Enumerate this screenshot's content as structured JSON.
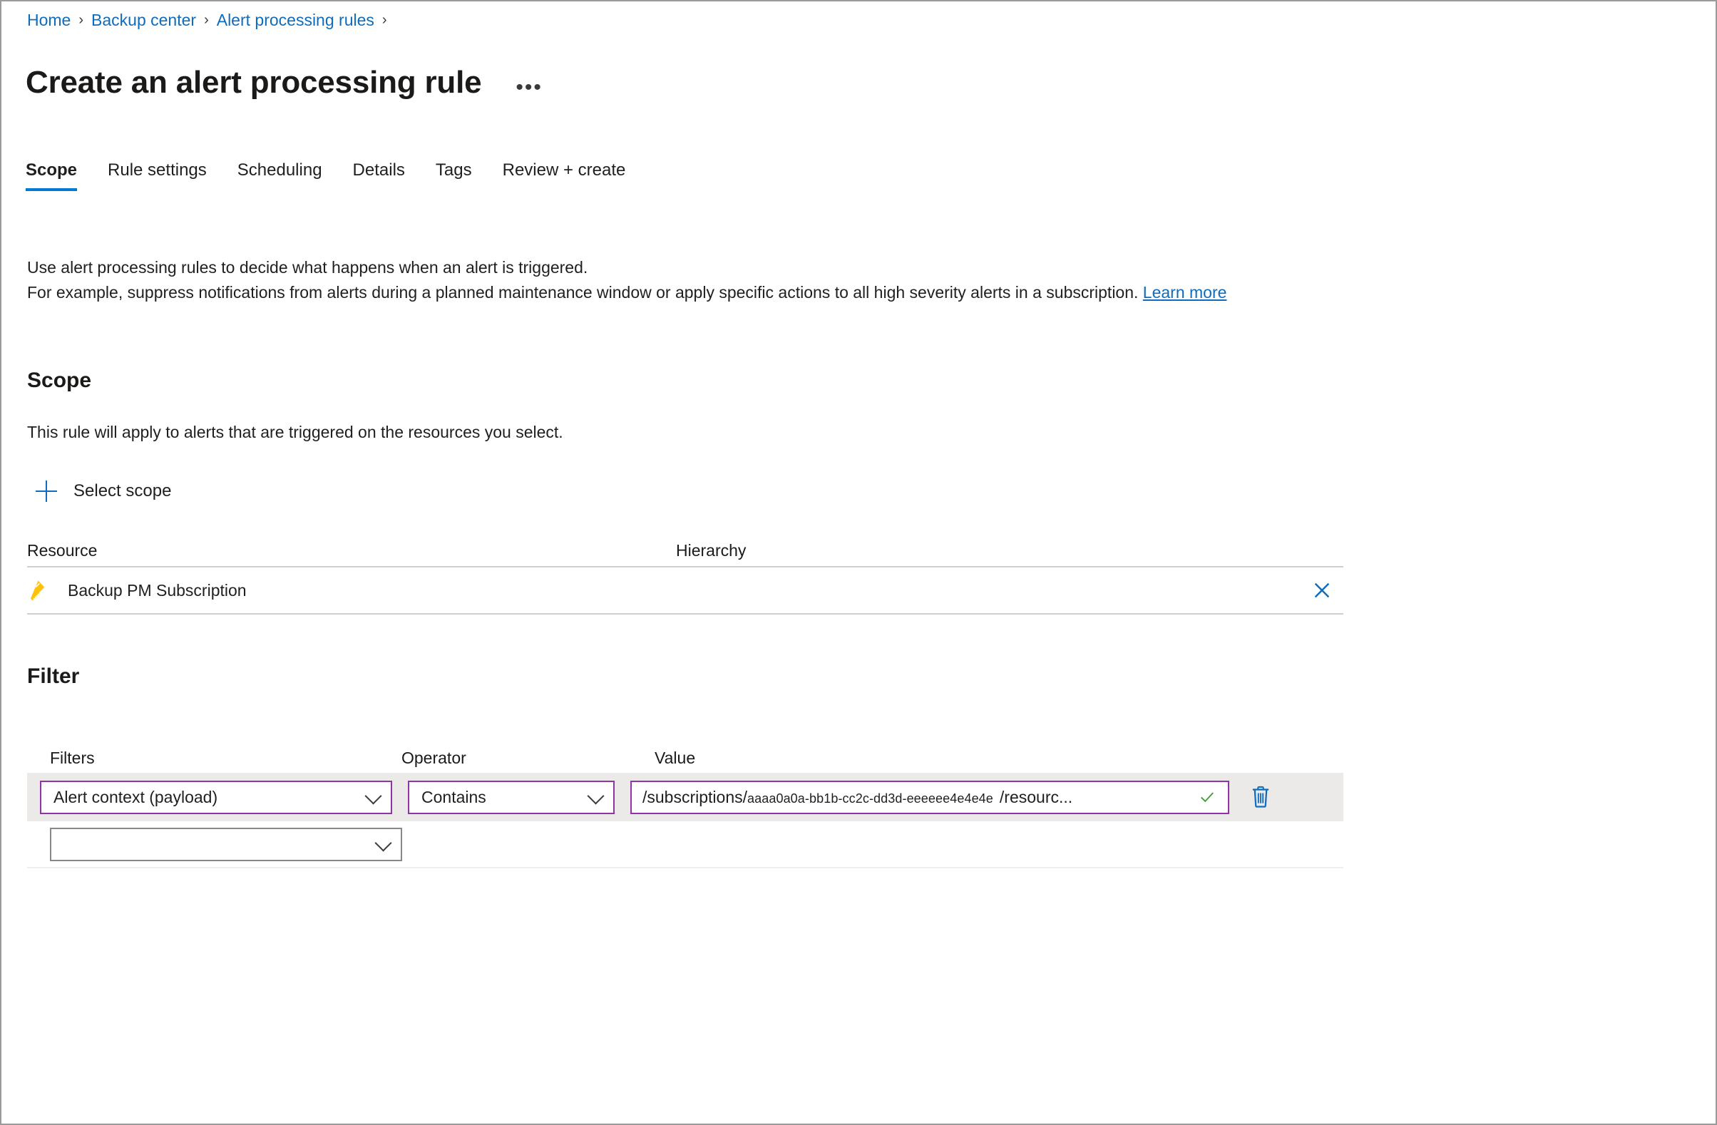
{
  "breadcrumb": {
    "items": [
      {
        "label": "Home"
      },
      {
        "label": "Backup center"
      },
      {
        "label": "Alert processing rules"
      }
    ],
    "separator": "›"
  },
  "header": {
    "title": "Create an alert processing rule",
    "more_actions": "•••"
  },
  "tabs": [
    {
      "label": "Scope",
      "active": true
    },
    {
      "label": "Rule settings",
      "active": false
    },
    {
      "label": "Scheduling",
      "active": false
    },
    {
      "label": "Details",
      "active": false
    },
    {
      "label": "Tags",
      "active": false
    },
    {
      "label": "Review + create",
      "active": false
    }
  ],
  "intro": {
    "line1": "Use alert processing rules to decide what happens when an alert is triggered.",
    "line2": "For example, suppress notifications from alerts during a planned maintenance window or apply specific actions to all high severity alerts in a subscription.",
    "link": "Learn more"
  },
  "scope": {
    "heading": "Scope",
    "description": "This rule will apply to alerts that are triggered on the resources you select.",
    "select_scope_label": "Select scope",
    "table": {
      "columns": [
        "Resource",
        "Hierarchy"
      ],
      "rows": [
        {
          "resource": "Backup PM Subscription",
          "hierarchy": "",
          "icon": "subscription-key-icon"
        }
      ]
    }
  },
  "filter": {
    "heading": "Filter",
    "columns": [
      "Filters",
      "Operator",
      "Value"
    ],
    "rows": [
      {
        "filter": "Alert context (payload)",
        "operator": "Contains",
        "value_prefix": "/subscriptions/",
        "value_guid": "aaaa0a0a-bb1b-cc2c-dd3d-eeeeee4e4e4e",
        "value_suffix": "/resourc...",
        "valid": true
      },
      {
        "filter": "",
        "operator": "",
        "value": ""
      }
    ]
  },
  "colors": {
    "link_blue": "#0f6cbd",
    "tab_accent": "#0078d4",
    "field_focus_purple": "#9333a8",
    "valid_green": "#107c10",
    "key_icon_yellow": "#ffc107",
    "row_highlight": "#ebeae9"
  }
}
